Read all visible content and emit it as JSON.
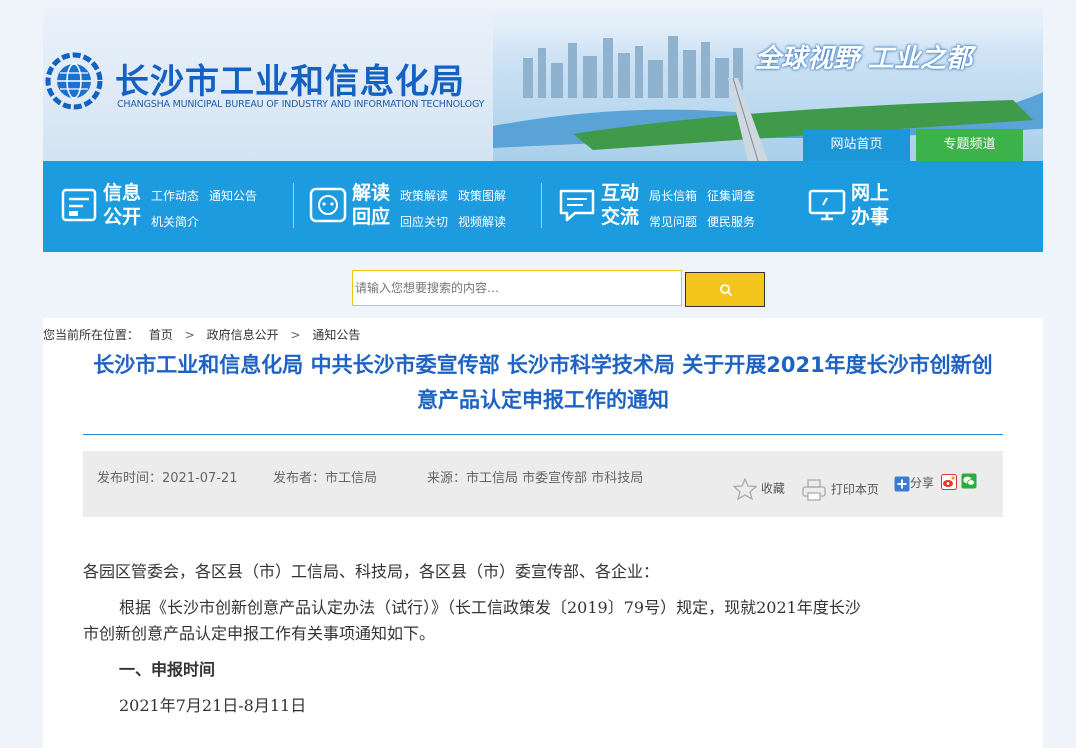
{
  "header": {
    "org_cn": "长沙市工业和信息化局",
    "org_en": "CHANGSHA MUNICIPAL BUREAU OF INDUSTRY AND INFORMATION TECHNOLOGY",
    "slogan": "全球视野 工业之都",
    "tabs": [
      {
        "label": "网站首页",
        "color": "#1d96d8"
      },
      {
        "label": "专题频道",
        "color": "#3cb34a"
      }
    ]
  },
  "nav": [
    {
      "icon": "document-icon",
      "title": "信息公开",
      "links": [
        "工作动态",
        "通知公告",
        "机关简介"
      ]
    },
    {
      "icon": "interpret-icon",
      "title": "解读回应",
      "links": [
        "政策解读",
        "政策图解",
        "回应关切",
        "视频解读"
      ]
    },
    {
      "icon": "chat-bubble-icon",
      "title": "互动交流",
      "links": [
        "局长信箱",
        "征集调查",
        "常见问题",
        "便民服务"
      ]
    },
    {
      "icon": "monitor-icon",
      "title": "网上办事",
      "links": []
    }
  ],
  "search": {
    "placeholder": "请输入您想要搜索的内容…",
    "button_icon": "search-icon"
  },
  "breadcrumb": {
    "prefix": "您当前所在位置：",
    "items": [
      "首页",
      "政府信息公开",
      "通知公告"
    ]
  },
  "article": {
    "title": "长沙市工业和信息化局 中共长沙市委宣传部 长沙市科学技术局 关于开展2021年度长沙市创新创意产品认定申报工作的通知",
    "publish_time": "发布时间：2021-07-21",
    "publisher": "发布者：市工信局",
    "source": "来源：市工信局 市委宣传部 市科技局",
    "actions": {
      "favorite": "收藏",
      "print": "打印本页",
      "share": "分享"
    },
    "paragraphs": [
      "各园区管委会，各区县（市）工信局、科技局，各区县（市）委宣传部、各企业：",
      "根据《长沙市创新创意产品认定办法（试行）》（长工信政策发〔2019〕79号）规定，现就2021年度长沙",
      "市创新创意产品认定申报工作有关事项通知如下。",
      "一、申报时间",
      "2021年7月21日-8月11日"
    ]
  },
  "colors": {
    "nav_bg": "#1c9bdf",
    "title_blue": "#1e63c4",
    "search_btn": "#f4c51c"
  }
}
